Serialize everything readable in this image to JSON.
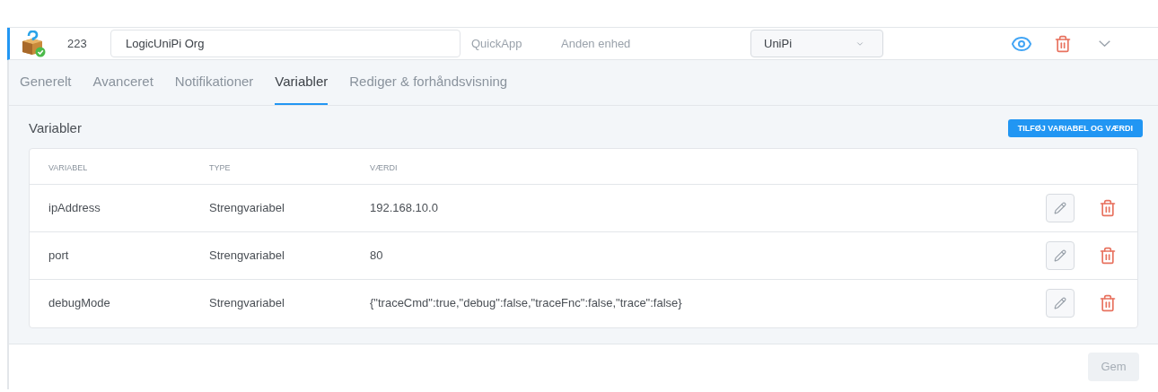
{
  "device": {
    "id": "223",
    "name": "LogicUniPi Org",
    "type": "QuickApp",
    "role": "Anden enhed",
    "room": "UniPi"
  },
  "tabs": [
    {
      "label": "Generelt",
      "selected": false
    },
    {
      "label": "Avanceret",
      "selected": false
    },
    {
      "label": "Notifikationer",
      "selected": false
    },
    {
      "label": "Variabler",
      "selected": true
    },
    {
      "label": "Rediger & forhåndsvisning",
      "selected": false
    }
  ],
  "section": {
    "title": "Variabler",
    "add_button": "TILFØJ VARIABEL OG VÆRDI"
  },
  "table": {
    "columns": [
      "VARIABEL",
      "TYPE",
      "VÆRDI"
    ],
    "rows": [
      {
        "name": "ipAddress",
        "type": "Strengvariabel",
        "value": "192.168.10.0"
      },
      {
        "name": "port",
        "type": "Strengvariabel",
        "value": "80"
      },
      {
        "name": "debugMode",
        "type": "Strengvariabel",
        "value": "{\"traceCmd\":true,\"debug\":false,\"traceFnc\":false,\"trace\":false}"
      }
    ]
  },
  "save_button": {
    "label": "Gem",
    "disabled": true
  }
}
